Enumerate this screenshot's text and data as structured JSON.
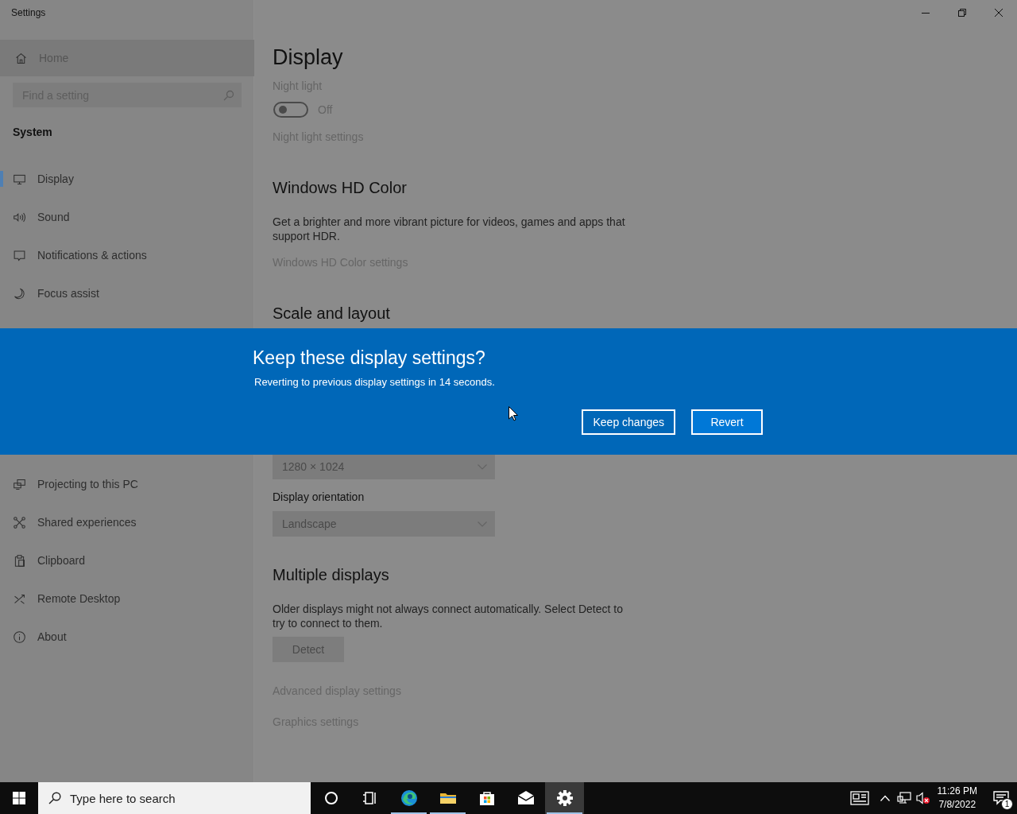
{
  "window": {
    "title": "Settings"
  },
  "sidebar": {
    "home": "Home",
    "search": {
      "placeholder": "Find a setting"
    },
    "section": "System",
    "items": [
      {
        "label": "Display",
        "kind": "display",
        "selected": true
      },
      {
        "label": "Sound",
        "kind": "sound",
        "selected": false
      },
      {
        "label": "Notifications & actions",
        "kind": "notifications",
        "selected": false
      },
      {
        "label": "Focus assist",
        "kind": "focus",
        "selected": false
      }
    ],
    "items_after_dialog": [
      {
        "label": "Projecting to this PC",
        "kind": "projecting",
        "selected": false
      },
      {
        "label": "Shared experiences",
        "kind": "shared",
        "selected": false
      },
      {
        "label": "Clipboard",
        "kind": "clipboard",
        "selected": false
      },
      {
        "label": "Remote Desktop",
        "kind": "remote",
        "selected": false
      },
      {
        "label": "About",
        "kind": "about",
        "selected": false
      }
    ]
  },
  "page": {
    "title": "Display",
    "content": [
      {
        "kind": "label",
        "text": "Night light",
        "disabled": true
      },
      {
        "kind": "toggle",
        "on": false,
        "text": "Off"
      },
      {
        "kind": "link",
        "text": "Night light settings",
        "disabled": true
      },
      {
        "kind": "heading",
        "text": "Windows HD Color"
      },
      {
        "kind": "paragraph",
        "text": "Get a brighter and more vibrant picture for videos, games and apps that support HDR."
      },
      {
        "kind": "link",
        "text": "Windows HD Color settings",
        "disabled": true
      },
      {
        "kind": "heading",
        "text": "Scale and layout"
      }
    ],
    "content_after_dialog": [
      {
        "kind": "dropdown",
        "value": "1280 × 1024",
        "disabled": true
      },
      {
        "kind": "label",
        "text": "Display orientation",
        "disabled": false
      },
      {
        "kind": "dropdown",
        "value": "Landscape",
        "disabled": true
      },
      {
        "kind": "heading",
        "text": "Multiple displays"
      },
      {
        "kind": "paragraph",
        "text": "Older displays might not always connect automatically. Select Detect to try to connect to them."
      },
      {
        "kind": "button",
        "text": "Detect",
        "disabled": true
      },
      {
        "kind": "link",
        "text": "Advanced display settings",
        "disabled": true
      },
      {
        "kind": "link",
        "text": "Graphics settings",
        "disabled": true
      }
    ]
  },
  "dialog": {
    "title": "Keep these display settings?",
    "message": "Reverting to previous display settings in 14 seconds.",
    "buttons": [
      {
        "label": "Keep changes",
        "kind": "secondary"
      },
      {
        "label": "Revert",
        "kind": "primary"
      }
    ]
  },
  "taskbar": {
    "search": {
      "placeholder": "Type here to search"
    },
    "apps": [
      {
        "kind": "cortana",
        "active": false,
        "running": false
      },
      {
        "kind": "task_view",
        "active": false,
        "running": false
      },
      {
        "kind": "edge",
        "active": false,
        "running": true
      },
      {
        "kind": "explorer",
        "active": false,
        "running": true
      },
      {
        "kind": "store",
        "active": false,
        "running": false
      },
      {
        "kind": "mail",
        "active": false,
        "running": false
      },
      {
        "kind": "settings",
        "active": true,
        "running": true
      }
    ],
    "time": "11:26 PM",
    "date": "7/8/2022",
    "notification_count": "1"
  }
}
